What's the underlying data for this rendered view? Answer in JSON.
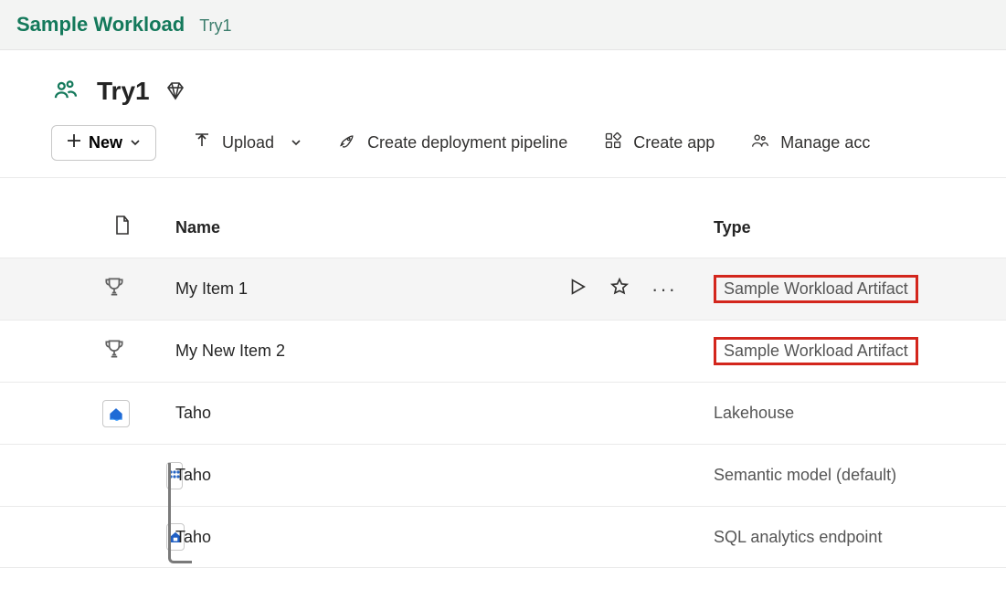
{
  "breadcrumb": {
    "app": "Sample Workload",
    "workspace": "Try1"
  },
  "workspace": {
    "name": "Try1"
  },
  "toolbar": {
    "new_label": "New",
    "upload_label": "Upload",
    "pipeline_label": "Create deployment pipeline",
    "create_app_label": "Create app",
    "manage_access_label": "Manage acc"
  },
  "table": {
    "headers": {
      "name": "Name",
      "type": "Type"
    },
    "rows": [
      {
        "name": "My Item 1",
        "type": "Sample Workload Artifact",
        "highlighted": true,
        "show_actions": true
      },
      {
        "name": "My New Item 2",
        "type": "Sample Workload Artifact",
        "highlighted": true,
        "show_actions": false
      },
      {
        "name": "Taho",
        "type": "Lakehouse",
        "highlighted": false,
        "show_actions": false
      }
    ],
    "children": [
      {
        "name": "Taho",
        "type": "Semantic model (default)"
      },
      {
        "name": "Taho",
        "type": "SQL analytics endpoint"
      }
    ]
  }
}
